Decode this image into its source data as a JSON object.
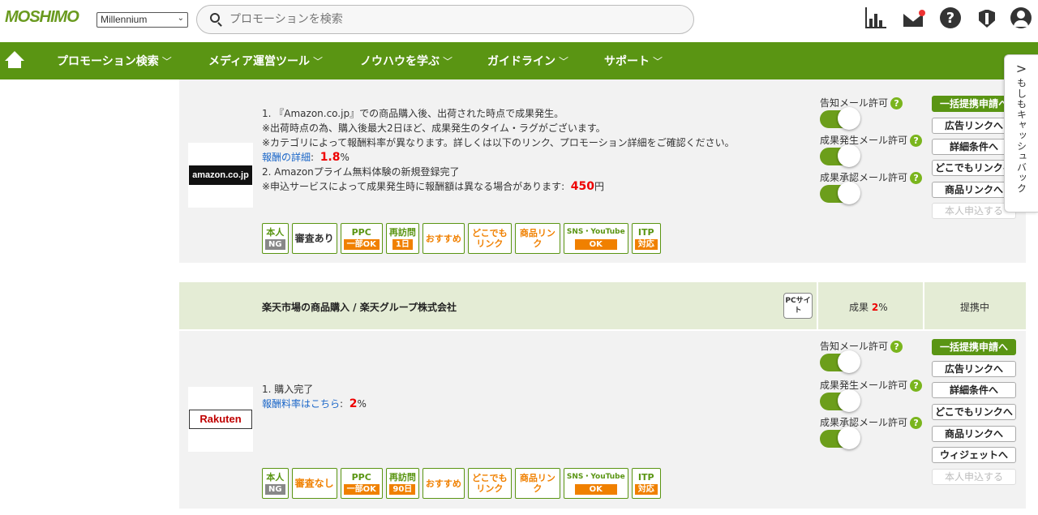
{
  "header": {
    "logo": "MOSHIMO",
    "site_select": "Millennium",
    "search_placeholder": "プロモーションを検索"
  },
  "nav": {
    "items": [
      {
        "label": "プロモーション検索"
      },
      {
        "label": "メディア運営ツール"
      },
      {
        "label": "ノウハウを学ぶ"
      },
      {
        "label": "ガイドライン"
      },
      {
        "label": "サポート"
      }
    ],
    "chevron": "﹀"
  },
  "cashback_tab": {
    "arrow": ">",
    "label": "もしもキャッシュバック"
  },
  "promotions": [
    {
      "logo_text": "amazon.co.jp",
      "lines": [
        "1. 『Amazon.co.jp』での商品購入後、出荷された時点で成果発生。",
        "※出荷時点の為、購入後最大2日ほど、成果発生のタイム・ラグがございます。",
        "※カテゴリによって報酬料率が異なります。詳しくは以下のリンク、プロモーション詳細をご確認ください。"
      ],
      "reward_link": "報酬の詳細",
      "reward_value": "1.8",
      "reward_unit": "%",
      "line2": "2. Amazonプライム無料体験の新規登録完了",
      "line3": "※申込サービスによって成果発生時に報酬額は異なる場合があります:",
      "line3_value": "450",
      "line3_unit": "円",
      "tags": [
        {
          "t1": "本人",
          "t2": "NG"
        },
        {
          "t1": "審査あり"
        },
        {
          "t1": "PPC",
          "t2": "一部OK"
        },
        {
          "t1": "再訪問",
          "t2": "1日"
        },
        {
          "t1": "おすすめ"
        },
        {
          "t1": "どこでもリンク"
        },
        {
          "t1": "商品リンク"
        },
        {
          "t1": "SNS・YouTube",
          "t2": "OK"
        },
        {
          "t1": "ITP",
          "t2": "対応"
        }
      ],
      "mail": [
        "告知メール許可",
        "成果発生メール許可",
        "成果承認メール許可"
      ],
      "buttons": [
        "一括提携申請へ",
        "広告リンクへ",
        "詳細条件へ",
        "どこでもリンクへ",
        "商品リンクへ",
        "本人申込する"
      ]
    },
    {
      "title": "楽天市場の商品購入 / 楽天グループ株式会社",
      "badge": "PCサイト",
      "rate_label": "成果",
      "rate_value": "2",
      "rate_unit": "%",
      "status": "提携中",
      "logo_text": "Rakuten",
      "line1": "1. 購入完了",
      "reward_link": "報酬料率はこちら",
      "reward_value": "2",
      "reward_unit": "%",
      "tags": [
        {
          "t1": "本人",
          "t2": "NG"
        },
        {
          "t1": "審査なし"
        },
        {
          "t1": "PPC",
          "t2": "一部OK"
        },
        {
          "t1": "再訪問",
          "t2": "90日"
        },
        {
          "t1": "おすすめ"
        },
        {
          "t1": "どこでもリンク"
        },
        {
          "t1": "商品リンク"
        },
        {
          "t1": "SNS・YouTube",
          "t2": "OK"
        },
        {
          "t1": "ITP",
          "t2": "対応"
        }
      ],
      "mail": [
        "告知メール許可",
        "成果発生メール許可",
        "成果承認メール許可"
      ],
      "buttons": [
        "一括提携申請へ",
        "広告リンクへ",
        "詳細条件へ",
        "どこでもリンクへ",
        "商品リンクへ",
        "ウィジェットへ",
        "本人申込する"
      ]
    }
  ]
}
